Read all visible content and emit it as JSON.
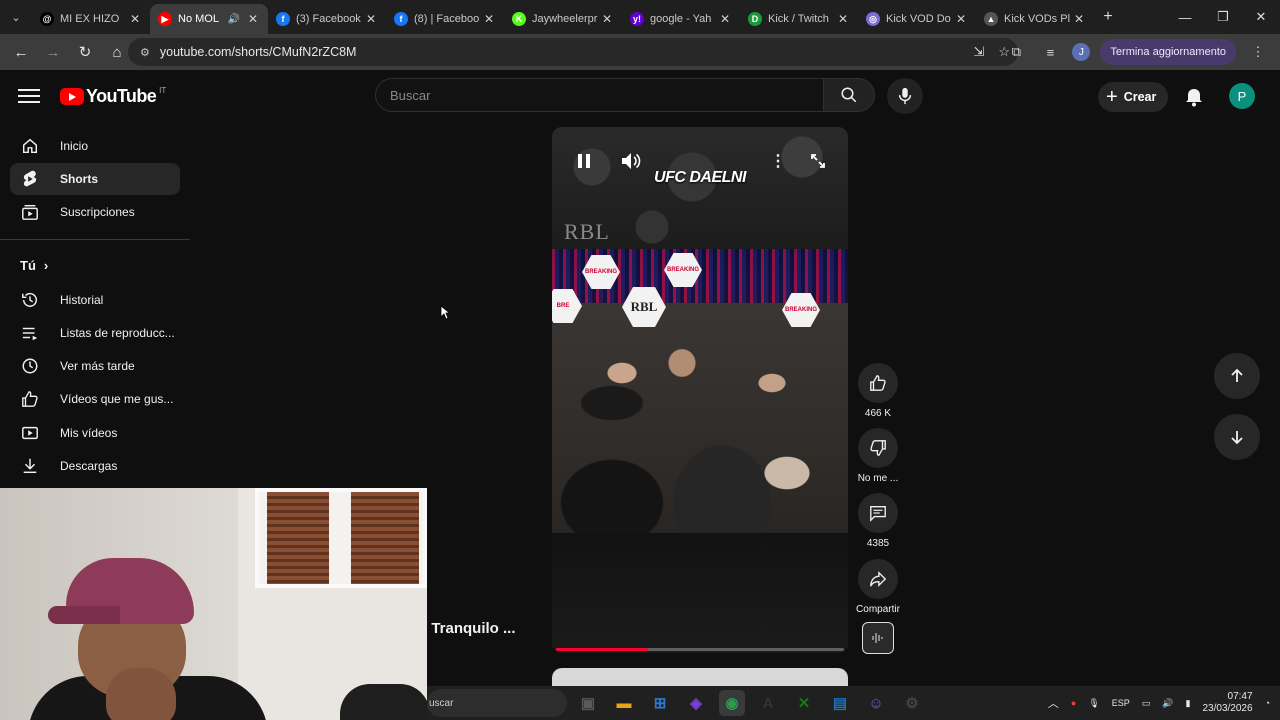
{
  "browser": {
    "tabs": [
      {
        "title": "MI EX HIZO",
        "icon": "threads-icon",
        "color": "#000000",
        "glyph": "@"
      },
      {
        "title": "No MOL",
        "icon": "youtube-icon",
        "color": "#ff0000",
        "glyph": "▶",
        "active": true,
        "audio": true
      },
      {
        "title": "(3) Facebook",
        "icon": "facebook-icon",
        "color": "#1877f2",
        "glyph": "f"
      },
      {
        "title": "(8) | Faceboo",
        "icon": "facebook-icon",
        "color": "#1877f2",
        "glyph": "f"
      },
      {
        "title": "Jaywheelerpr",
        "icon": "kick-icon",
        "color": "#53fc18",
        "glyph": "K"
      },
      {
        "title": "google - Yah",
        "icon": "yahoo-icon",
        "color": "#6001d2",
        "glyph": "y!"
      },
      {
        "title": "Kick / Twitch",
        "icon": "d-icon",
        "color": "#1b9a3c",
        "glyph": "D"
      },
      {
        "title": "Kick VOD Do",
        "icon": "kickvod-icon",
        "color": "#7b6cd9",
        "glyph": "◎"
      },
      {
        "title": "Kick VODs Pl",
        "icon": "kickvods-icon",
        "color": "#555555",
        "glyph": "▲"
      }
    ],
    "url": "youtube.com/shorts/CMufN2rZC8M",
    "profile_initial": "J",
    "update_label": "Termina aggiornamento"
  },
  "youtube": {
    "logo_text": "YouTube",
    "country_code": "IT",
    "search_placeholder": "Buscar",
    "create_label": "Crear",
    "avatar_initial": "P"
  },
  "sidebar": {
    "items": [
      {
        "label": "Inicio",
        "icon": "home-icon"
      },
      {
        "label": "Shorts",
        "icon": "shorts-icon",
        "selected": true
      },
      {
        "label": "Suscripciones",
        "icon": "subscriptions-icon"
      }
    ],
    "you_label": "Tú",
    "you_items": [
      {
        "label": "Historial",
        "icon": "history-icon"
      },
      {
        "label": "Listas de reproducc...",
        "icon": "playlists-icon"
      },
      {
        "label": "Ver más tarde",
        "icon": "watch-later-icon"
      },
      {
        "label": "Vídeos que me gus...",
        "icon": "liked-icon"
      },
      {
        "label": "Mis vídeos",
        "icon": "my-videos-icon"
      },
      {
        "label": "Descargas",
        "icon": "downloads-icon"
      }
    ]
  },
  "short": {
    "overlay_title": "UFC DAELNI",
    "badge_text": "RBL",
    "progress": 0.32,
    "channel_title_partial": "o Tranquilo ..."
  },
  "actions": {
    "like_count": "466 K",
    "dislike_label": "No me ...",
    "comment_count": "4385",
    "share_label": "Compartir"
  },
  "taskbar": {
    "search_text": "uscar",
    "apps": [
      {
        "icon": "task-view-icon",
        "color": "#5a5a5a",
        "glyph": "▣"
      },
      {
        "icon": "file-explorer-icon",
        "color": "#e8a317",
        "glyph": "▬"
      },
      {
        "icon": "store-icon",
        "color": "#2b79d6",
        "glyph": "⊞"
      },
      {
        "icon": "app-purple-icon",
        "color": "#7d3fd8",
        "glyph": "◈"
      },
      {
        "icon": "chrome-icon",
        "color": "#2b9e4e",
        "glyph": "◉",
        "active": true
      },
      {
        "icon": "app-a-icon",
        "color": "#333333",
        "glyph": "A"
      },
      {
        "icon": "xbox-icon",
        "color": "#107c10",
        "glyph": "✕"
      },
      {
        "icon": "app-window-icon",
        "color": "#1f6fbf",
        "glyph": "▤"
      },
      {
        "icon": "discord-icon",
        "color": "#5865f2",
        "glyph": "☺"
      },
      {
        "icon": "steam-icon",
        "color": "#444444",
        "glyph": "⚙"
      }
    ],
    "language": "ESP",
    "time": "07:47",
    "date": "23/03/2026"
  }
}
